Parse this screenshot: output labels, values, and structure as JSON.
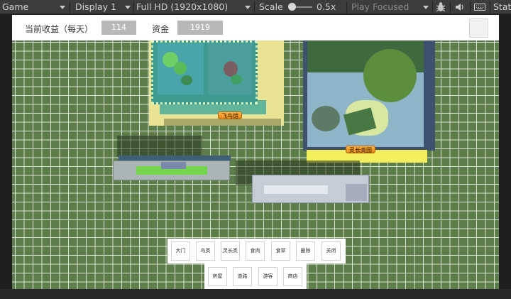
{
  "toolbar": {
    "view": "Game",
    "display": "Display 1",
    "resolution": "Full HD (1920x1080)",
    "scale_label": "Scale",
    "scale_value": "0.5x",
    "play_mode": "Play Focused",
    "stats": "Stat"
  },
  "hud": {
    "income_label": "当前收益（每天）",
    "income_value": "114",
    "funds_label": "资金",
    "funds_value": "1919"
  },
  "scene": {
    "sign_birds": "飞鸟馆",
    "sign_primates": "灵长类园"
  },
  "menu": {
    "row1": [
      "大门",
      "鸟类",
      "灵长类",
      "食肉",
      "食草",
      "删除",
      "关闭"
    ],
    "row2": [
      "房屋",
      "道路",
      "游客",
      "商店"
    ]
  },
  "colors": {
    "grass": "#5d7d4a",
    "grid_line": "#ffffff",
    "value_box": "#b8b8b8",
    "sign": "#f0a030",
    "editor_toolbar": "#3c3c3c"
  }
}
